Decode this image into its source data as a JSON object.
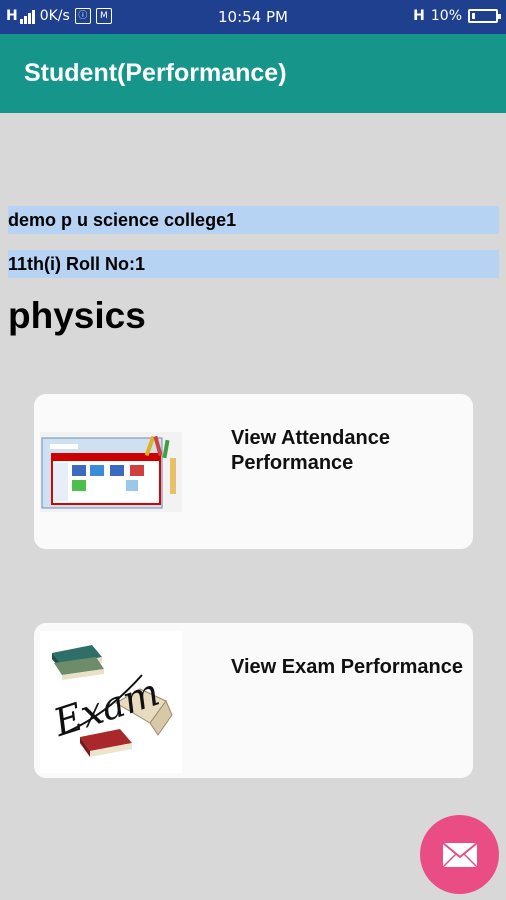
{
  "status_bar": {
    "network_speed": "0K/s",
    "time": "10:54 PM",
    "network_type": "H",
    "battery_percent": "10%"
  },
  "app_bar": {
    "title": "Student(Performance)"
  },
  "info": {
    "college": "demo p u science college1",
    "class_roll": "11th(i) Roll No:1",
    "subject": "physics"
  },
  "cards": [
    {
      "label": "View Attendance Performance"
    },
    {
      "label": "View Exam Performance"
    }
  ],
  "exam_image_text": "Exam",
  "fab": {
    "icon": "mail-icon",
    "color": "#ea4c84"
  },
  "colors": {
    "app_bar": "#16968a",
    "status_bar": "#1f3f8f",
    "highlight": "#b7d3f4"
  }
}
